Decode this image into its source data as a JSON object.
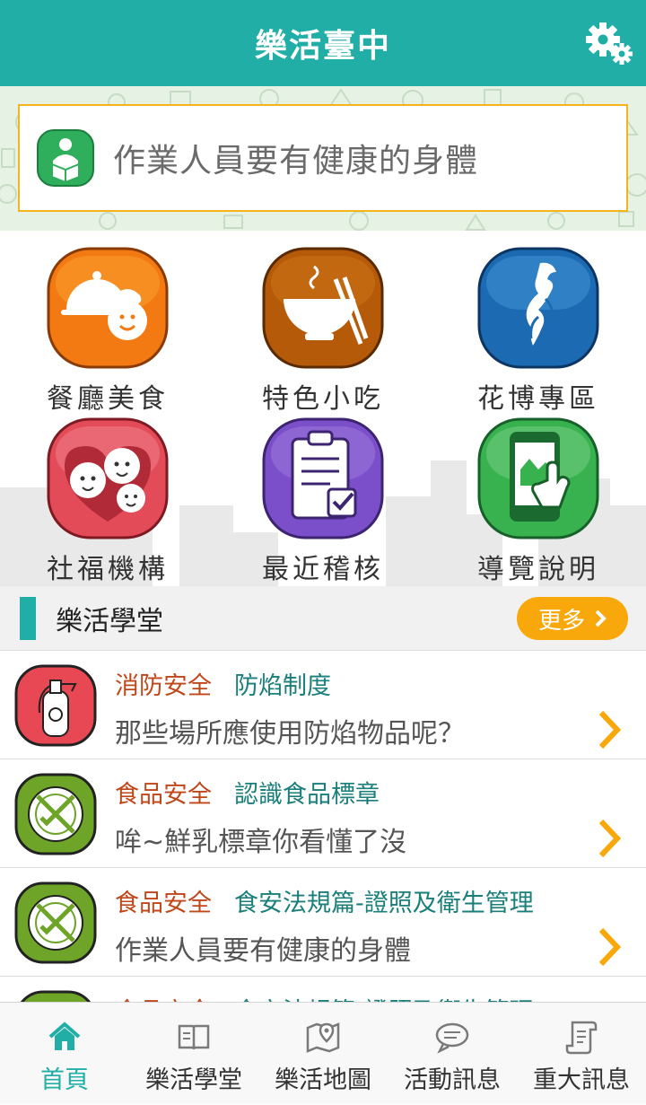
{
  "header": {
    "title": "樂活臺中",
    "settings_icon": "gear-icon"
  },
  "banner": {
    "icon": "reading-person-icon",
    "text": "作業人員要有健康的身體"
  },
  "grid": [
    {
      "label": "餐廳美食",
      "icon": "chef-cloche-icon"
    },
    {
      "label": "特色小吃",
      "icon": "noodle-bowl-icon"
    },
    {
      "label": "花博專區",
      "icon": "flora-expo-icon"
    },
    {
      "label": "社福機構",
      "icon": "family-heart-icon"
    },
    {
      "label": "最近稽核",
      "icon": "clipboard-check-icon"
    },
    {
      "label": "導覽說明",
      "icon": "phone-touch-icon"
    }
  ],
  "section": {
    "title": "樂活學堂",
    "more_label": "更多"
  },
  "articles": [
    {
      "category": "消防安全",
      "subcategory": "防焰制度",
      "title": "那些場所應使用防焰物品呢？",
      "icon": "fire-extinguisher-icon"
    },
    {
      "category": "食品安全",
      "subcategory": "認識食品標章",
      "title": "哞~鮮乳標章你看懂了沒",
      "icon": "plate-cutlery-icon"
    },
    {
      "category": "食品安全",
      "subcategory": "食安法規篇-證照及衛生管理",
      "title": "作業人員要有健康的身體",
      "icon": "plate-cutlery-icon"
    },
    {
      "category": "食品安全",
      "subcategory": "食安法規篇-證照及衛生管理",
      "title": "",
      "icon": "plate-cutlery-icon"
    }
  ],
  "nav": [
    {
      "label": "首頁",
      "icon": "home-icon",
      "active": true
    },
    {
      "label": "樂活學堂",
      "icon": "book-icon",
      "active": false
    },
    {
      "label": "樂活地圖",
      "icon": "map-pin-icon",
      "active": false
    },
    {
      "label": "活動訊息",
      "icon": "chat-bubble-icon",
      "active": false
    },
    {
      "label": "重大訊息",
      "icon": "scroll-icon",
      "active": false
    }
  ],
  "colors": {
    "primary": "#21aea6",
    "accent": "#f8a80a",
    "category_text": "#c0471a",
    "subcategory_text": "#1a7f7a"
  }
}
